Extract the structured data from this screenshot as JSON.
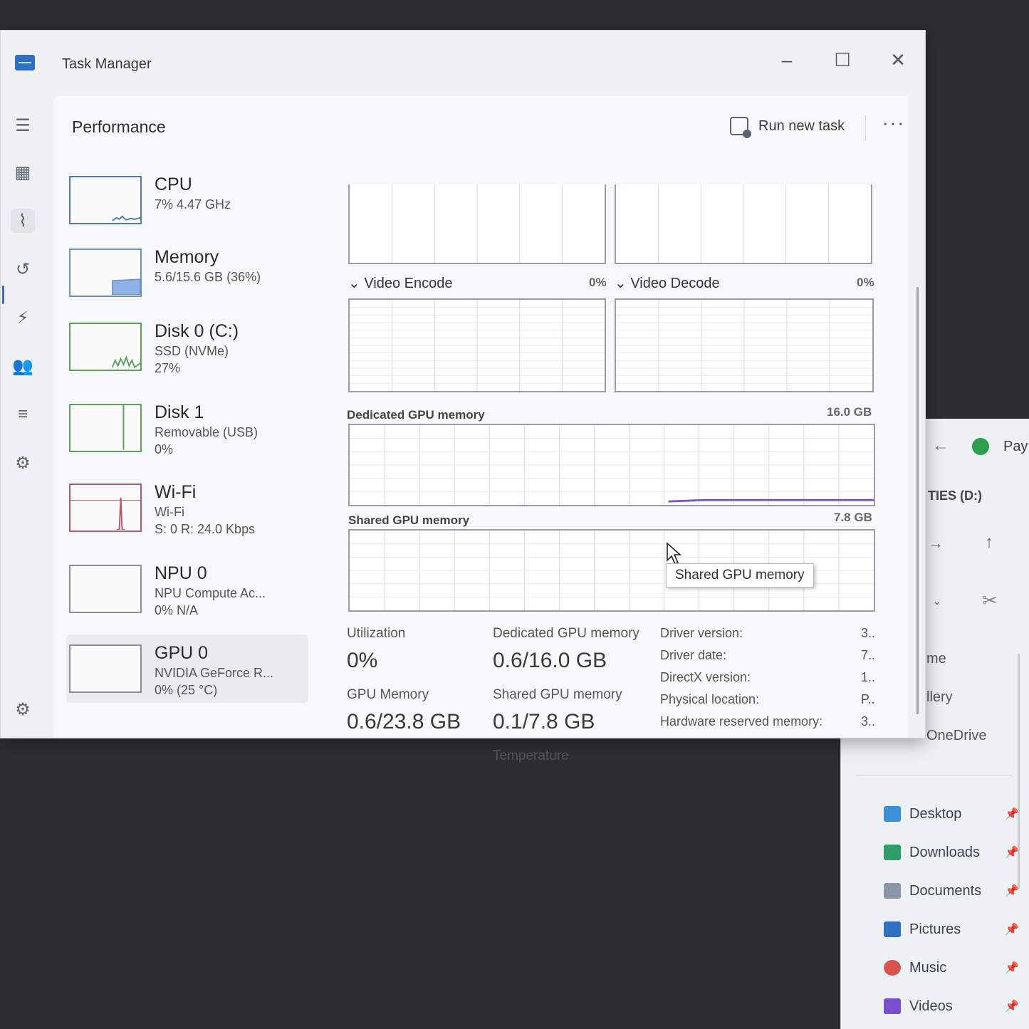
{
  "window": {
    "title": "Task Manager"
  },
  "header": {
    "page_title": "Performance",
    "run_new_task": "Run new task",
    "more": "···"
  },
  "nav": [
    "menu-icon",
    "processes-icon",
    "performance-icon",
    "app-history-icon",
    "startup-apps-icon",
    "users-icon",
    "details-icon",
    "services-icon",
    "settings-icon"
  ],
  "devices": [
    {
      "name": "CPU",
      "sub1": "7%  4.47 GHz",
      "sub2": ""
    },
    {
      "name": "Memory",
      "sub1": "5.6/15.6 GB (36%)",
      "sub2": ""
    },
    {
      "name": "Disk 0 (C:)",
      "sub1": "SSD (NVMe)",
      "sub2": "27%"
    },
    {
      "name": "Disk 1",
      "sub1": "Removable (USB)",
      "sub2": "0%"
    },
    {
      "name": "Wi-Fi",
      "sub1": "Wi-Fi",
      "sub2": "S: 0  R: 24.0 Kbps"
    },
    {
      "name": "NPU 0",
      "sub1": "NPU Compute Ac...",
      "sub2": "0%  N/A"
    },
    {
      "name": "GPU 0",
      "sub1": "NVIDIA GeForce R...",
      "sub2": "0%  (25 °C)"
    }
  ],
  "graphs": {
    "video_encode": {
      "label": "Video Encode",
      "value": "0%"
    },
    "video_decode": {
      "label": "Video Decode",
      "value": "0%"
    },
    "dedicated": {
      "label": "Dedicated GPU memory",
      "max": "16.0 GB"
    },
    "shared": {
      "label": "Shared GPU memory",
      "max": "7.8 GB"
    }
  },
  "tooltip": "Shared GPU memory",
  "stats": {
    "utilization_label": "Utilization",
    "utilization": "0%",
    "dedicated_label": "Dedicated GPU memory",
    "dedicated": "0.6/16.0 GB",
    "gpu_memory_label": "GPU Memory",
    "gpu_memory": "0.6/23.8 GB",
    "shared_label": "Shared GPU memory",
    "shared": "0.1/7.8 GB",
    "temperature_label": "Temperature"
  },
  "driver_info": [
    {
      "key": "Driver version:",
      "value": "3.."
    },
    {
      "key": "Driver date:",
      "value": "7.."
    },
    {
      "key": "DirectX version:",
      "value": "1.."
    },
    {
      "key": "Physical location:",
      "value": "P.."
    },
    {
      "key": "Hardware reserved memory:",
      "value": "3.."
    }
  ],
  "explorer": {
    "tab_title": "Pay",
    "drive": "TIES (D:)",
    "side": [
      "me",
      "llery",
      "OneDrive"
    ],
    "quick_access": [
      {
        "label": "Desktop",
        "color": "#3b8fd8"
      },
      {
        "label": "Downloads",
        "color": "#2e9e6a"
      },
      {
        "label": "Documents",
        "color": "#8a96a8"
      },
      {
        "label": "Pictures",
        "color": "#2f6fc4"
      },
      {
        "label": "Music",
        "color": "#d9534f"
      },
      {
        "label": "Videos",
        "color": "#7a4fcf"
      }
    ]
  }
}
